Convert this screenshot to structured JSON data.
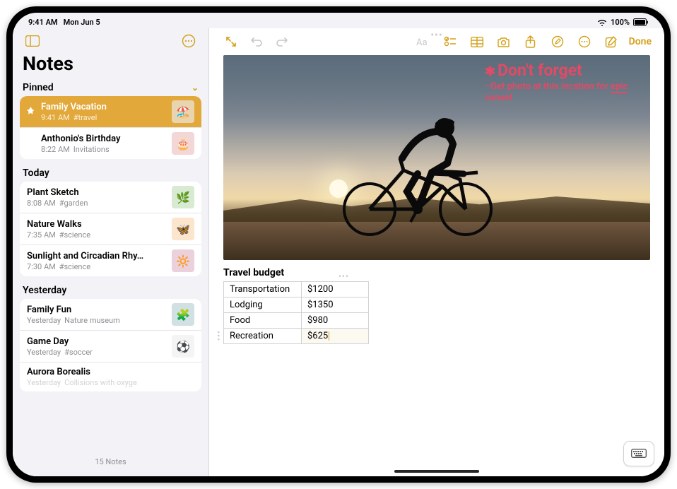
{
  "status": {
    "time": "9:41 AM",
    "date": "Mon Jun 5",
    "battery": "100%"
  },
  "sidebar": {
    "title": "Notes",
    "footer": "15 Notes",
    "sections": {
      "pinned": {
        "label": "Pinned"
      },
      "today": {
        "label": "Today"
      },
      "yesterday": {
        "label": "Yesterday"
      }
    },
    "pinned_items": [
      {
        "title": "Family Vacation",
        "time": "9:41 AM",
        "tag": "#travel",
        "selected": true
      },
      {
        "title": "Anthonio's Birthday",
        "time": "8:22 AM",
        "tag": "Invitations",
        "selected": false
      }
    ],
    "today_items": [
      {
        "title": "Plant Sketch",
        "time": "8:08 AM",
        "tag": "#garden"
      },
      {
        "title": "Nature Walks",
        "time": "7:35 AM",
        "tag": "#science"
      },
      {
        "title": "Sunlight and Circadian Rhy…",
        "time": "7:30 AM",
        "tag": "#science"
      }
    ],
    "yesterday_items": [
      {
        "title": "Family Fun",
        "time": "Yesterday",
        "tag": "Nature museum"
      },
      {
        "title": "Game Day",
        "time": "Yesterday",
        "tag": "#soccer"
      },
      {
        "title": "Aurora Borealis",
        "time": "Yesterday",
        "tag": "Collisions with oxyge"
      }
    ]
  },
  "editor": {
    "done_label": "Done",
    "annotation": {
      "headline": "Don't forget",
      "subline_pre": "–Get photo at this location for ",
      "subline_em": "epic",
      "subline_post": " sunset"
    },
    "table": {
      "title": "Travel budget",
      "rows": [
        {
          "label": "Transportation",
          "value": "$1200"
        },
        {
          "label": "Lodging",
          "value": "$1350"
        },
        {
          "label": "Food",
          "value": "$980"
        },
        {
          "label": "Recreation",
          "value": "$625"
        }
      ]
    }
  },
  "icons": {
    "thumbs": [
      "🏖️",
      "🎂",
      "🌿",
      "🦋",
      "🔆",
      "🧩",
      "⚽",
      "🌌"
    ]
  }
}
